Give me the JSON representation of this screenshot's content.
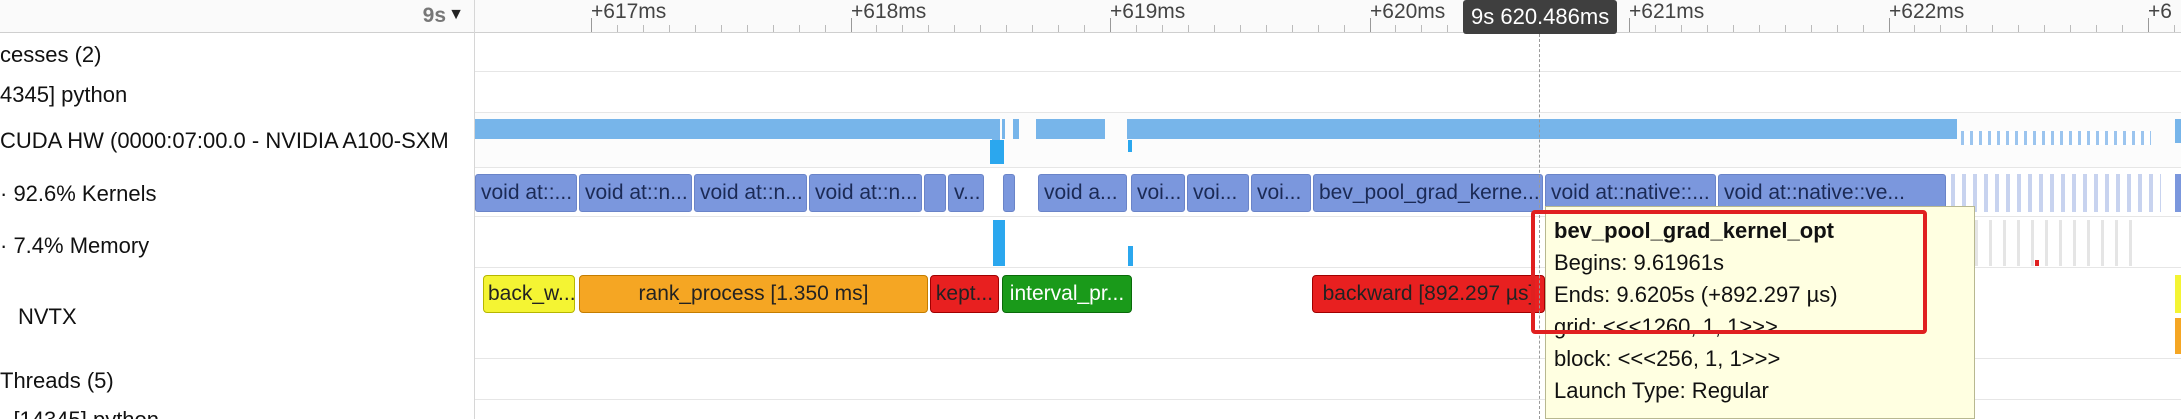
{
  "header": {
    "zoom_label": "9s",
    "ticks": [
      "+617ms",
      "+618ms",
      "+619ms",
      "+620ms",
      "+621ms",
      "+622ms",
      "+6"
    ],
    "cursor_time": "9s 620.486ms"
  },
  "tree": {
    "rows": [
      {
        "label": "cesses (2)"
      },
      {
        "label": "4345] python"
      },
      {
        "label": "CUDA HW (0000:07:00.0 - NVIDIA A100-SXM"
      },
      {
        "label": "· 92.6% Kernels"
      },
      {
        "label": "· 7.4% Memory"
      },
      {
        "label": "NVTX"
      },
      {
        "label": "Threads (5)"
      },
      {
        "label": "· [14345] python"
      }
    ]
  },
  "kernels": [
    {
      "label": "void at::..."
    },
    {
      "label": "void at::n..."
    },
    {
      "label": "void at::n..."
    },
    {
      "label": "void at::n..."
    },
    {
      "label": ""
    },
    {
      "label": "v..."
    },
    {
      "label": ""
    },
    {
      "label": "void a..."
    },
    {
      "label": "voi..."
    },
    {
      "label": "voi..."
    },
    {
      "label": "voi..."
    },
    {
      "label": "bev_pool_grad_kerne..."
    },
    {
      "label": "void at::native::..."
    },
    {
      "label": "void at::native::ve..."
    }
  ],
  "nvtx": [
    {
      "label": "back_w...",
      "color": "#f4f433"
    },
    {
      "label": "rank_process [1.350 ms]",
      "color": "#f5a623"
    },
    {
      "label": "kept...",
      "color": "#e82020"
    },
    {
      "label": "interval_pr...",
      "color": "#1a9a1a"
    },
    {
      "label": "backward [892.297 µs]",
      "color": "#e82020"
    }
  ],
  "tooltip": {
    "title": "bev_pool_grad_kernel_opt",
    "begins": "Begins: 9.61961s",
    "ends": "Ends: 9.6205s (+892.297 µs)",
    "grid": "grid:  <<<1260, 1, 1>>>",
    "block": "block: <<<256, 1, 1>>>",
    "launch_type": "Launch Type: Regular"
  },
  "colors": {
    "kernel": "#7b97dd",
    "hw_activity": "#77b5ea",
    "memory": "#2ba7ee",
    "highlight": "#e02020",
    "tooltip_bg": "#ffffe1"
  }
}
